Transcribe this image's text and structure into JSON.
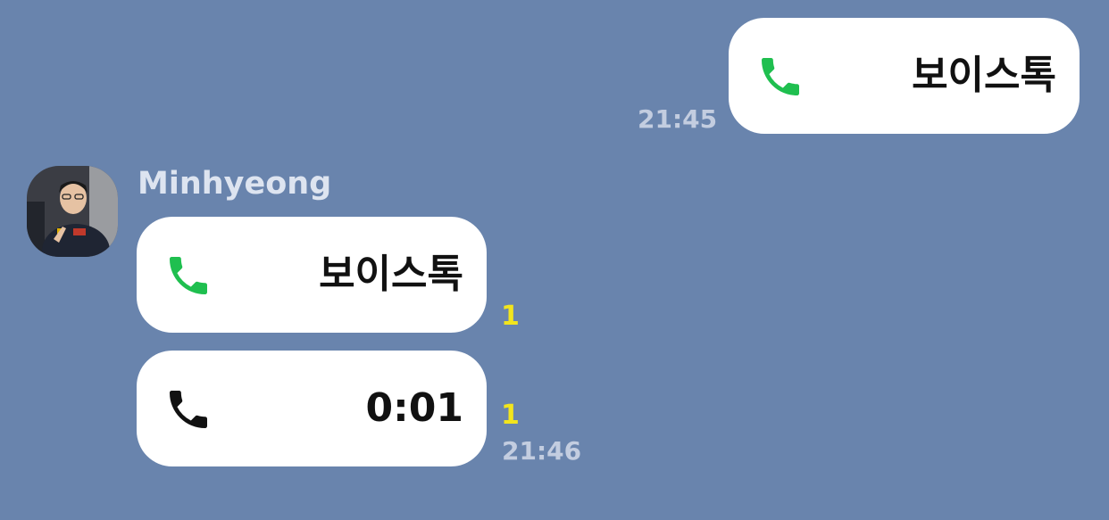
{
  "colors": {
    "background": "#6984ad",
    "bubble": "#ffffff",
    "call_icon_active": "#1fbf4f",
    "call_icon_ended": "#111111",
    "unread": "#f2e51d",
    "timestamp": "#c3cde0"
  },
  "messages": [
    {
      "direction": "outgoing",
      "icon": "phone-icon",
      "text": "보이스톡",
      "time": "21:45"
    },
    {
      "direction": "incoming",
      "sender": "Minhyeong",
      "icon": "phone-icon",
      "text": "보이스톡",
      "unread": "1"
    },
    {
      "direction": "incoming",
      "icon": "phone-ended-icon",
      "text": "0:01",
      "unread": "1",
      "time": "21:46"
    }
  ]
}
